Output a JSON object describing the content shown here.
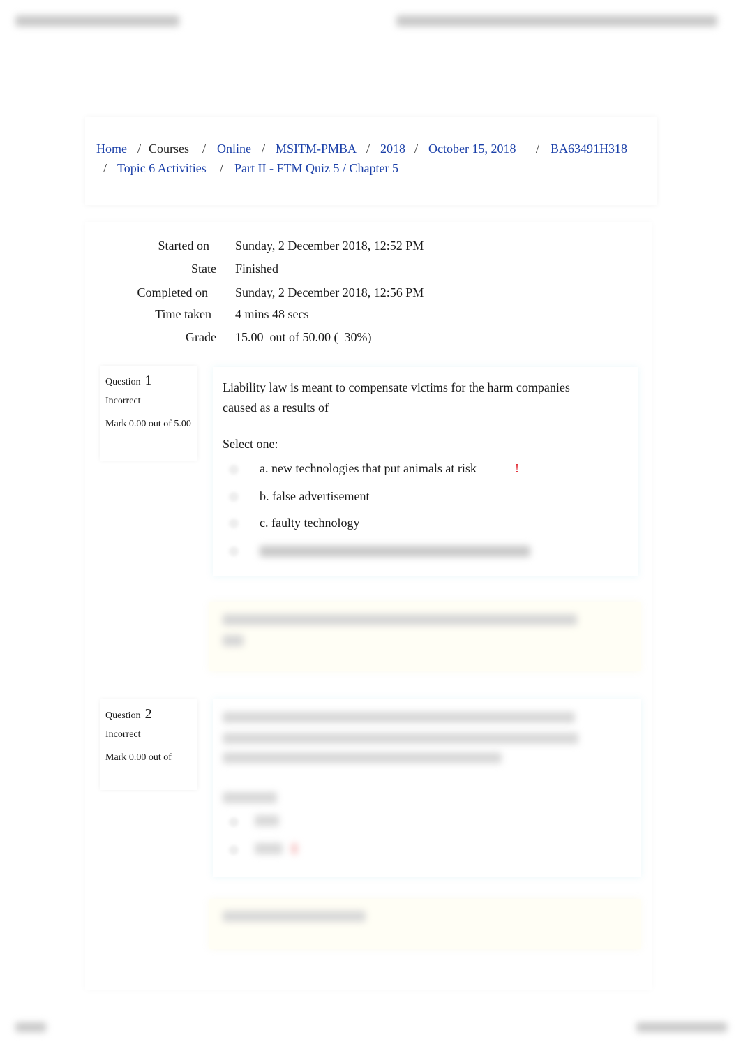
{
  "breadcrumb": [
    {
      "label": "Home",
      "link": true
    },
    {
      "label": "Courses",
      "link": false
    },
    {
      "label": "Online",
      "link": true
    },
    {
      "label": "MSITM-PMBA",
      "link": true
    },
    {
      "label": "2018",
      "link": true
    },
    {
      "label": "October 15, 2018",
      "link": true
    },
    {
      "label": "BA63491H318",
      "link": true
    },
    {
      "label": "Topic 6 Activities",
      "link": true
    },
    {
      "label": "Part II - FTM Quiz 5 / Chapter 5",
      "link": true
    }
  ],
  "summary": [
    {
      "label": "Started on",
      "value": "Sunday, 2 December 2018, 12:52 PM"
    },
    {
      "label": "State",
      "value": "Finished"
    },
    {
      "label": "Completed on",
      "value": "Sunday, 2 December 2018, 12:56 PM"
    },
    {
      "label": "Time taken",
      "value": "4 mins 48 secs"
    },
    {
      "label": "Grade",
      "value": "15.00  out of 50.00 (  30%)"
    }
  ],
  "questions": [
    {
      "label": "Question",
      "number": "1",
      "status": "Incorrect",
      "mark": "Mark 0.00 out of 5.00",
      "text": "Liability law is meant to compensate victims for the harm companies caused as a results of",
      "prompt": "Select one:",
      "options": [
        "a. new technologies that put animals at risk",
        "b. false advertisement",
        "c. faulty technology"
      ],
      "incorrect_marker": "!"
    },
    {
      "label": "Question",
      "number": "2",
      "status": "Incorrect",
      "mark": "Mark 0.00 out of"
    }
  ],
  "colors": {
    "link": "#1a3fa8",
    "incorrect": "#e0202a"
  }
}
